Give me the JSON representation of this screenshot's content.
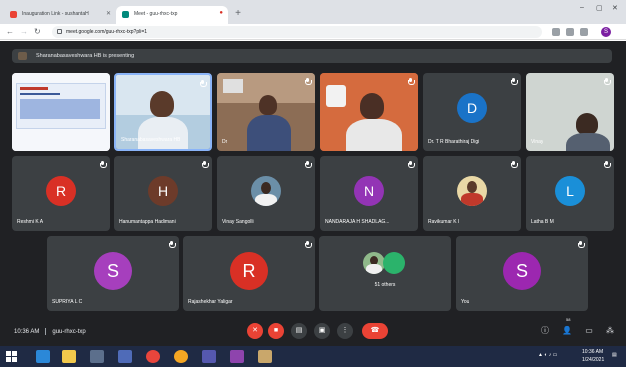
{
  "browser": {
    "tabs": [
      {
        "label": "Inauguration Link - sushantaH",
        "active": false
      },
      {
        "label": "Meet - guu-rhxc-txp",
        "active": true
      }
    ],
    "new_tab_icon": "plus-icon",
    "url": "meet.google.com/guu-rhxc-txp?pli=1",
    "profile_initial": "S",
    "colors": {
      "tabbar": "#dee1e6",
      "active_tab": "#ffffff"
    }
  },
  "meet": {
    "presenting_text": "Sharanabasaveshwara HB is presenting",
    "tiles": [
      {
        "kind": "screen",
        "name": ""
      },
      {
        "kind": "video",
        "name": "Sharanabasaveshwara HB"
      },
      {
        "kind": "video",
        "name": "Dr"
      },
      {
        "kind": "video",
        "name": ""
      },
      {
        "kind": "initial",
        "initial": "D",
        "name": "Dr. T R Bharathiraj Digi",
        "color": "#1a73c8"
      },
      {
        "kind": "video",
        "name": "Vinay"
      },
      {
        "kind": "initial",
        "initial": "R",
        "name": "Reshmi K A",
        "color": "#d93025"
      },
      {
        "kind": "initial",
        "initial": "H",
        "name": "Hanumantappa Hadimani",
        "color": "#6d3b2a"
      },
      {
        "kind": "photo",
        "name": "Vinay Sangolli"
      },
      {
        "kind": "initial",
        "initial": "N",
        "name": "NANDARAJA H SHADLAG...",
        "color": "#9334b5"
      },
      {
        "kind": "photo",
        "name": "Ravikumar K I"
      },
      {
        "kind": "initial",
        "initial": "L",
        "name": "Latha B M",
        "color": "#1a8fd8"
      },
      {
        "kind": "initial",
        "initial": "S",
        "name": "SUPRIYA L C",
        "color": "#a63fbd"
      },
      {
        "kind": "initial",
        "initial": "R",
        "name": "Rajashekhar Yaligar",
        "color": "#d93025"
      },
      {
        "kind": "others",
        "name": "51 others"
      },
      {
        "kind": "initial",
        "initial": "S",
        "name": "You",
        "color": "#9c27b0"
      }
    ],
    "time": "10:36 AM",
    "meeting_code": "guu-rhxc-txp",
    "controls": [
      "mic-off-icon",
      "camera-off-icon",
      "captions-icon",
      "present-icon",
      "more-icon",
      "end-call-icon"
    ],
    "right_controls": [
      "info-icon",
      "people-icon",
      "chat-icon",
      "activities-icon"
    ],
    "right_badge": "58",
    "colors": {
      "stage": "#202124",
      "tile": "#3c4043",
      "danger": "#ea4335"
    }
  },
  "taskbar": {
    "icons": [
      "windows-start-icon",
      "edge-icon",
      "file-explorer-icon",
      "calculator-icon",
      "chrome-icon",
      "store-icon",
      "firefox-icon",
      "teams-icon",
      "photos-icon"
    ],
    "tray_time": "10:36 AM",
    "tray_date": "1/24/2021"
  }
}
